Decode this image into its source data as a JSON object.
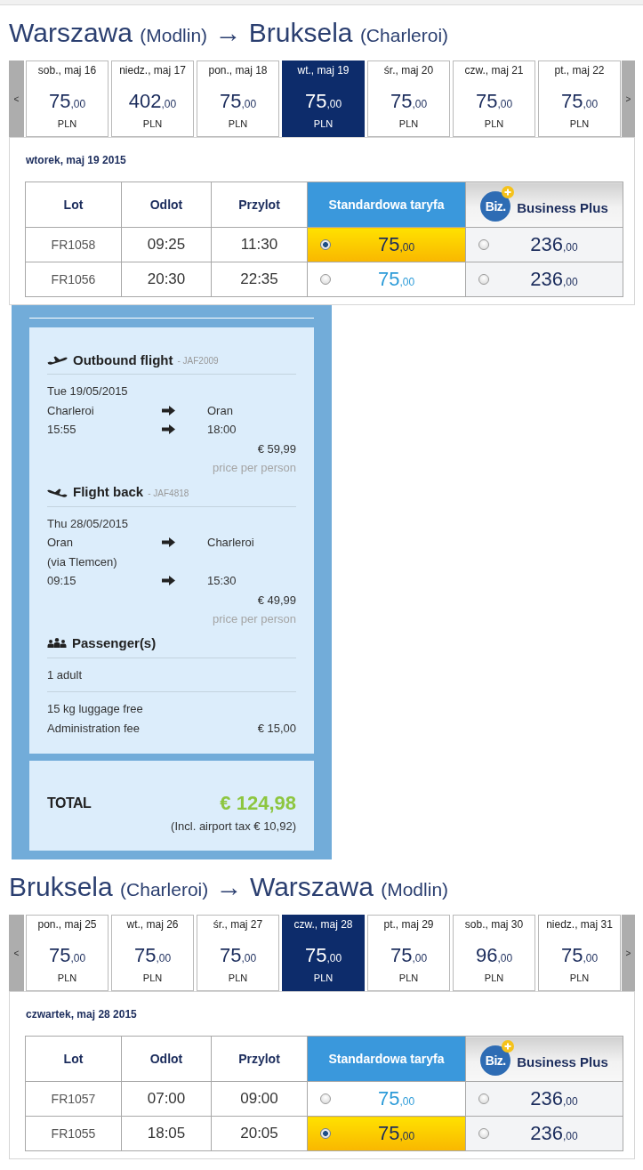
{
  "outbound": {
    "route": {
      "from_city": "Warszawa",
      "from_airport": "(Modlin)",
      "arrow": "→",
      "to_city": "Bruksela",
      "to_airport": "(Charleroi)"
    },
    "dates": {
      "prev": "<",
      "next": ">",
      "items": [
        {
          "date": "sob., maj 16",
          "price": "75",
          "decimals": ",00",
          "currency": "PLN",
          "selected": false
        },
        {
          "date": "niedz., maj 17",
          "price": "402",
          "decimals": ",00",
          "currency": "PLN",
          "selected": false
        },
        {
          "date": "pon., maj 18",
          "price": "75",
          "decimals": ",00",
          "currency": "PLN",
          "selected": false
        },
        {
          "date": "wt., maj 19",
          "price": "75",
          "decimals": ",00",
          "currency": "PLN",
          "selected": true
        },
        {
          "date": "śr., maj 20",
          "price": "75",
          "decimals": ",00",
          "currency": "PLN",
          "selected": false
        },
        {
          "date": "czw., maj 21",
          "price": "75",
          "decimals": ",00",
          "currency": "PLN",
          "selected": false
        },
        {
          "date": "pt., maj 22",
          "price": "75",
          "decimals": ",00",
          "currency": "PLN",
          "selected": false
        }
      ]
    },
    "selected_date": "wtorek, maj 19 2015",
    "fare_table": {
      "columns": [
        {
          "label": "Lot",
          "kind": "plain"
        },
        {
          "label": "Odlot",
          "kind": "plain"
        },
        {
          "label": "Przylot",
          "kind": "plain"
        },
        {
          "label": "Standardowa taryfa",
          "kind": "standard"
        },
        {
          "label": "Business Plus",
          "kind": "business",
          "logo": "Biz."
        }
      ],
      "rows": [
        {
          "flight": "FR1058",
          "departure": "09:25",
          "arrival": "11:30",
          "fares": [
            {
              "kind": "standard",
              "price": "75",
              "decimals": ",00",
              "selected": true
            },
            {
              "kind": "business",
              "price": "236",
              "decimals": ",00",
              "selected": false
            }
          ]
        },
        {
          "flight": "FR1056",
          "departure": "20:30",
          "arrival": "22:35",
          "fares": [
            {
              "kind": "standard",
              "price": "75",
              "decimals": ",00",
              "selected": false
            },
            {
              "kind": "business",
              "price": "236",
              "decimals": ",00",
              "selected": false
            }
          ]
        }
      ]
    }
  },
  "summary": {
    "flights": [
      {
        "kind": "outbound",
        "title": "Outbound flight",
        "code": "- JAF2009",
        "date": "Tue 19/05/2015",
        "route_rows": [
          {
            "kind": "pair",
            "from": "Charleroi",
            "to": "Oran"
          },
          {
            "kind": "pair",
            "from": "15:55",
            "to": "18:00"
          }
        ],
        "price": "€ 59,99",
        "price_note": "price per person"
      },
      {
        "kind": "return",
        "title": "Flight back",
        "code": "- JAF4818",
        "date": "Thu 28/05/2015",
        "route_rows": [
          {
            "kind": "pair",
            "from": "Oran",
            "to": "Charleroi"
          },
          {
            "kind": "note",
            "text": "(via Tlemcen)"
          },
          {
            "kind": "pair",
            "from": "09:15",
            "to": "15:30"
          }
        ],
        "price": "€ 49,99",
        "price_note": "price per person"
      }
    ],
    "passengers": {
      "title": "Passenger(s)",
      "count": "1 adult"
    },
    "extras": [
      {
        "label": "15 kg luggage free"
      },
      {
        "label": "Administration fee",
        "value": "€ 15,00"
      }
    ],
    "total": {
      "label": "TOTAL",
      "amount": "€ 124,98",
      "tax_note": "(Incl. airport tax € 10,92)"
    }
  },
  "return": {
    "route": {
      "from_city": "Bruksela",
      "from_airport": "(Charleroi)",
      "arrow": "→",
      "to_city": "Warszawa",
      "to_airport": "(Modlin)"
    },
    "dates": {
      "prev": "<",
      "next": ">",
      "items": [
        {
          "date": "pon., maj 25",
          "price": "75",
          "decimals": ",00",
          "currency": "PLN",
          "selected": false
        },
        {
          "date": "wt., maj 26",
          "price": "75",
          "decimals": ",00",
          "currency": "PLN",
          "selected": false
        },
        {
          "date": "śr., maj 27",
          "price": "75",
          "decimals": ",00",
          "currency": "PLN",
          "selected": false
        },
        {
          "date": "czw., maj 28",
          "price": "75",
          "decimals": ",00",
          "currency": "PLN",
          "selected": true
        },
        {
          "date": "pt., maj 29",
          "price": "75",
          "decimals": ",00",
          "currency": "PLN",
          "selected": false
        },
        {
          "date": "sob., maj 30",
          "price": "96",
          "decimals": ",00",
          "currency": "PLN",
          "selected": false
        },
        {
          "date": "niedz., maj 31",
          "price": "75",
          "decimals": ",00",
          "currency": "PLN",
          "selected": false
        }
      ]
    },
    "selected_date": "czwartek, maj 28 2015",
    "fare_table": {
      "columns": [
        {
          "label": "Lot",
          "kind": "plain"
        },
        {
          "label": "Odlot",
          "kind": "plain"
        },
        {
          "label": "Przylot",
          "kind": "plain"
        },
        {
          "label": "Standardowa taryfa",
          "kind": "standard"
        },
        {
          "label": "Business Plus",
          "kind": "business",
          "logo": "Biz."
        }
      ],
      "rows": [
        {
          "flight": "FR1057",
          "departure": "07:00",
          "arrival": "09:00",
          "fares": [
            {
              "kind": "standard",
              "price": "75",
              "decimals": ",00",
              "selected": false
            },
            {
              "kind": "business",
              "price": "236",
              "decimals": ",00",
              "selected": false
            }
          ]
        },
        {
          "flight": "FR1055",
          "departure": "18:05",
          "arrival": "20:05",
          "fares": [
            {
              "kind": "standard",
              "price": "75",
              "decimals": ",00",
              "selected": true
            },
            {
              "kind": "business",
              "price": "236",
              "decimals": ",00",
              "selected": false
            }
          ]
        }
      ]
    }
  }
}
